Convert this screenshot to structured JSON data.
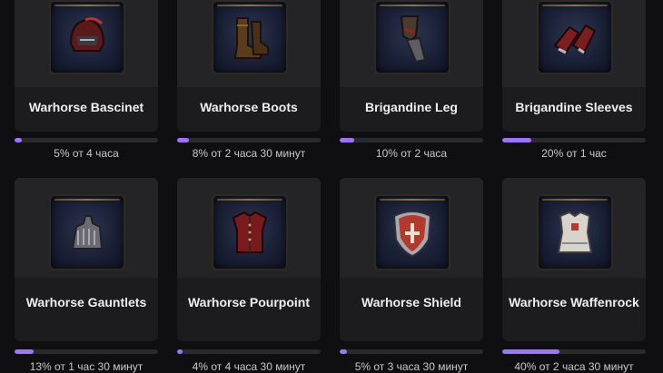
{
  "items": [
    {
      "name": "Warhorse Bascinet",
      "progress_text": "5% от 4 часа",
      "progress": 0.05,
      "icon": "helmet-icon"
    },
    {
      "name": "Warhorse Boots",
      "progress_text": "8% от 2 часа 30 минут",
      "progress": 0.08,
      "icon": "boots-icon"
    },
    {
      "name": "Brigandine Leg",
      "progress_text": "10% от 2 часа",
      "progress": 0.1,
      "icon": "leg-armor-icon"
    },
    {
      "name": "Brigandine Sleeves",
      "progress_text": "20% от 1 час",
      "progress": 0.2,
      "icon": "sleeves-icon"
    },
    {
      "name": "Warhorse Gauntlets",
      "progress_text": "13% от 1 час 30 минут",
      "progress": 0.13,
      "icon": "gauntlets-icon"
    },
    {
      "name": "Warhorse Pourpoint",
      "progress_text": "4% от 4 часа 30 минут",
      "progress": 0.04,
      "icon": "pourpoint-icon"
    },
    {
      "name": "Warhorse Shield",
      "progress_text": "5% от 3 часа 30 минут",
      "progress": 0.05,
      "icon": "shield-icon"
    },
    {
      "name": "Warhorse Waffenrock",
      "progress_text": "40% от 2 часа 30 минут",
      "progress": 0.4,
      "icon": "waffenrock-icon"
    }
  ],
  "colors": {
    "accent": "#9e73ff",
    "card": "#1c1c1f",
    "background": "#0f0f11"
  }
}
